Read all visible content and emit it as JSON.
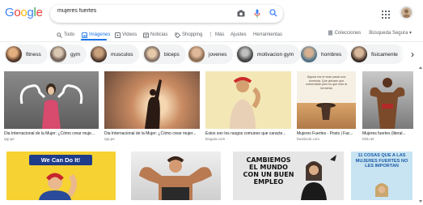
{
  "logo": {
    "letters": [
      "G",
      "o",
      "o",
      "g",
      "l",
      "e"
    ],
    "colors": [
      "#4285f4",
      "#ea4335",
      "#fbbc05",
      "#4285f4",
      "#34a853",
      "#ea4335"
    ]
  },
  "search": {
    "query": "mujeres fuertes"
  },
  "tabs": [
    {
      "label": "Todo",
      "icon": "search-icon"
    },
    {
      "label": "Imágenes",
      "icon": "image-icon",
      "active": true
    },
    {
      "label": "Videos",
      "icon": "video-icon"
    },
    {
      "label": "Noticias",
      "icon": "news-icon"
    },
    {
      "label": "Shopping",
      "icon": "tag-icon"
    },
    {
      "label": "Más",
      "icon": "more-icon"
    },
    {
      "label": "Ajustes"
    },
    {
      "label": "Herramientas"
    }
  ],
  "right_tabs": {
    "collections": "Colecciones",
    "safe_search": "Búsqueda Segura ▾"
  },
  "chips": [
    "fitness",
    "gym",
    "musculos",
    "biceps",
    "jovenes",
    "motivacion gym",
    "hombres",
    "fisicamente"
  ],
  "results_row1": [
    {
      "caption": "Dia Internacional de la Mujer: ¿Cómo crear muje...",
      "source": "rpp.pe"
    },
    {
      "caption": "Dia Internacional de la Mujer: ¿Cómo crear mujer...",
      "source": "rpp.pe"
    },
    {
      "caption": "Estos son los rasgos comunes que caracte...",
      "source": "bioguia.com"
    },
    {
      "caption": "Mujeres Fuertes - Posts | Fac...",
      "source": "facebook.com"
    },
    {
      "caption": "Mujeres fuertes (literal...",
      "source": "hiitt.net"
    }
  ],
  "image_texts": {
    "quote": "Alguna vez te vean pasar una tormenta. Que piensen que sobreviviste pero es que eras la tormenta",
    "we_can": "We Can Do It!",
    "cambiemos": "CAMBIEMOS EL MUNDO CON UN BUEN EMPLEO",
    "cosas": "11 COSAS QUE A LAS MUJERES FUERTES NO LES IMPORTAN"
  }
}
